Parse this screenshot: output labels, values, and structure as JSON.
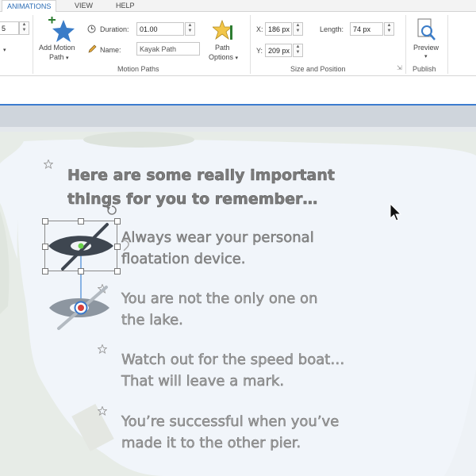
{
  "ribbon": {
    "tabs": [
      {
        "label": "ANIMATIONS",
        "active": true
      },
      {
        "label": "VIEW",
        "active": false
      },
      {
        "label": "HELP",
        "active": false
      }
    ],
    "left_value": "5",
    "add_motion_path": {
      "line1": "Add Motion",
      "line2": "Path"
    },
    "duration": {
      "label": "Duration:",
      "value": "01.00"
    },
    "name": {
      "label": "Name:",
      "value": "Kayak Path"
    },
    "path_options": {
      "line1": "Path",
      "line2": "Options"
    },
    "motion_paths_group": "Motion Paths",
    "x": {
      "label": "X:",
      "value": "186 px"
    },
    "y": {
      "label": "Y:",
      "value": "209 px"
    },
    "length": {
      "label": "Length:",
      "value": "74 px"
    },
    "size_position_group": "Size and Position",
    "preview": "Preview",
    "publish_group": "Publish"
  },
  "slide": {
    "title_line1": "Here are some really important",
    "title_line2": "things for you to remember…",
    "bullets": [
      {
        "line1": "Always wear your personal",
        "line2": "floatation device."
      },
      {
        "line1": "You are not the only one on",
        "line2": "the lake."
      },
      {
        "line1": "Watch out for the speed boat…",
        "line2": "That will leave a mark."
      },
      {
        "line1": "You’re successful when you’ve",
        "line2": "made it to the other pier."
      }
    ]
  },
  "colors": {
    "accent": "#2b6cb5",
    "lake": "#f1f5fa",
    "shore": "#e4e9e3",
    "motion_path": "#4f8fd8",
    "kayak": "#3e4650"
  }
}
